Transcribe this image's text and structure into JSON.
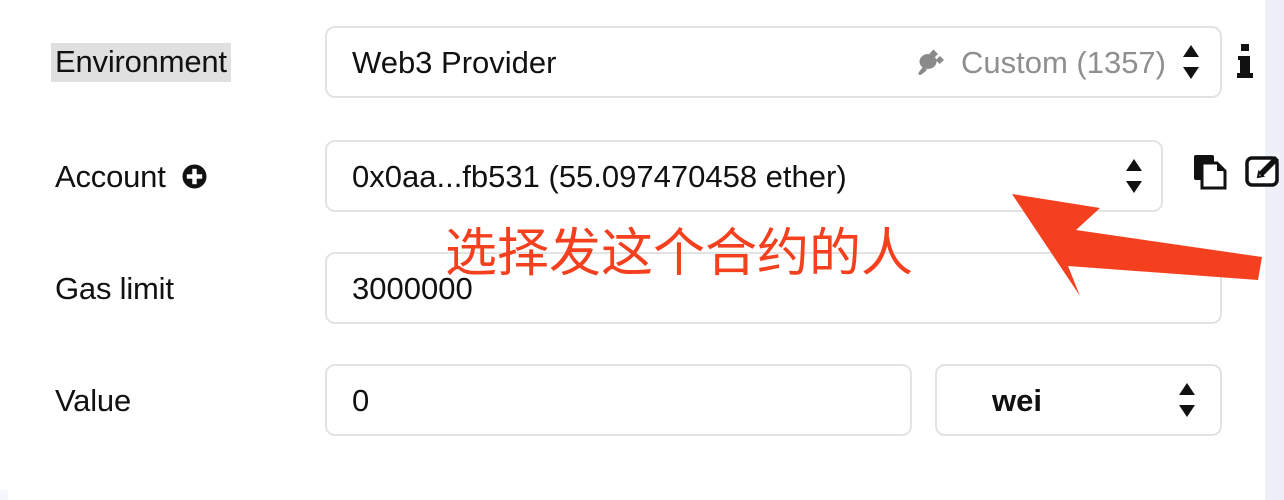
{
  "colors": {
    "accent_red": "#f4401e",
    "label_highlight": "#e0e0e0",
    "muted_text": "#8f8f8f",
    "border": "#e3e3e3",
    "page_strip": "#eef0f9"
  },
  "form": {
    "environment": {
      "label": "Environment",
      "provider": "Web3 Provider",
      "network": "Custom (1357)",
      "plug_icon": "plug-icon",
      "stepper_icon": "stepper-updown-icon",
      "info_icon": "info-icon"
    },
    "account": {
      "label": "Account",
      "add_icon": "plus-circle-icon",
      "value": "0x0aa...fb531 (55.097470458 ether)",
      "stepper_icon": "stepper-updown-icon",
      "copy_icon": "copy-icon",
      "sign_icon": "edit-sign-icon"
    },
    "gas_limit": {
      "label": "Gas limit",
      "value": "3000000"
    },
    "value": {
      "label": "Value",
      "value": "0",
      "unit": "wei",
      "stepper_icon": "stepper-updown-icon"
    }
  },
  "annotation": {
    "text": "选择发这个合约的人",
    "arrow_icon": "red-arrow-pointing-up-left"
  }
}
